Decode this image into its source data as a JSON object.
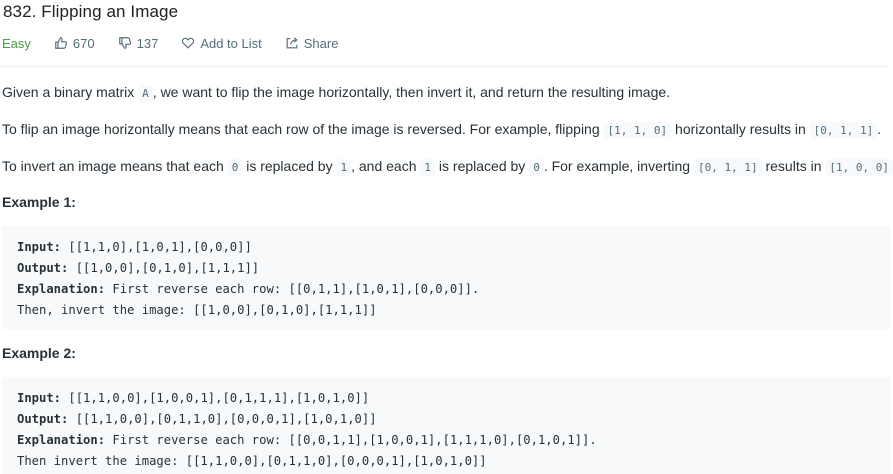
{
  "problem": {
    "title": "832. Flipping an Image",
    "difficulty": "Easy",
    "likes": "670",
    "dislikes": "137",
    "add_to_list": "Add to List",
    "share": "Share"
  },
  "description": {
    "p1": {
      "a": "Given a binary matrix ",
      "code": "A",
      "b": ", we want to flip the image horizontally, then invert it, and return the resulting image."
    },
    "p2": {
      "a": "To flip an image horizontally means that each row of the image is reversed.  For example, flipping ",
      "code": "[1, 1, 0]",
      "b": " horizontally results in ",
      "code2": "[0, 1, 1]",
      "c": "."
    },
    "p3": {
      "a": "To invert an image means that each ",
      "code": "0",
      "b": " is replaced by ",
      "code2": "1",
      "c": ", and each ",
      "code3": "1",
      "d": " is replaced by ",
      "code4": "0",
      "e": ". For example, inverting ",
      "code5": "[0, 1, 1]",
      "f": " results in ",
      "code6": "[1, 0, 0]",
      "g": "."
    }
  },
  "examples": [
    {
      "title": "Example 1:",
      "input_label": "Input:",
      "input": " [[1,1,0],[1,0,1],[0,0,0]]",
      "output_label": "Output:",
      "output": " [[1,0,0],[0,1,0],[1,1,1]]",
      "explanation_label": "Explanation:",
      "explanation": " First reverse each row: [[0,1,1],[1,0,1],[0,0,0]].",
      "then": "Then, invert the image: [[1,0,0],[0,1,0],[1,1,1]]"
    },
    {
      "title": "Example 2:",
      "input_label": "Input:",
      "input": " [[1,1,0,0],[1,0,0,1],[0,1,1,1],[1,0,1,0]]",
      "output_label": "Output:",
      "output": " [[1,1,0,0],[0,1,1,0],[0,0,0,1],[1,0,1,0]]",
      "explanation_label": "Explanation:",
      "explanation": " First reverse each row: [[0,0,1,1],[1,0,0,1],[1,1,1,0],[0,1,0,1]].",
      "then": "Then invert the image: [[1,1,0,0],[0,1,1,0],[0,0,0,1],[1,0,1,0]]"
    }
  ]
}
